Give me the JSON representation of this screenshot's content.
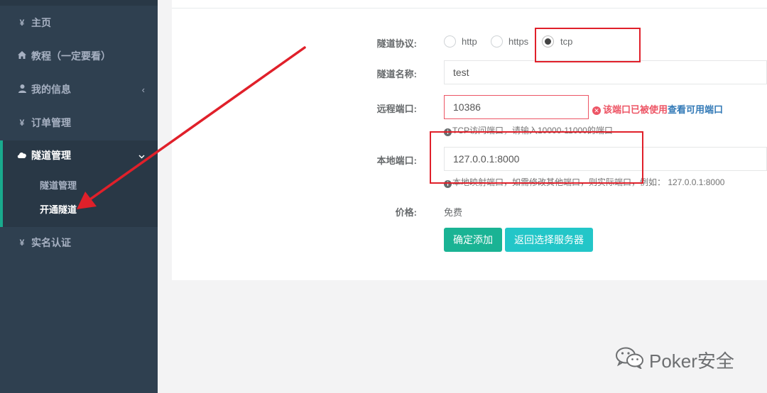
{
  "sidebar": {
    "items": [
      {
        "label": "主页",
        "icon": "yen-icon"
      },
      {
        "label": "教程（一定要看）",
        "icon": "home-icon"
      },
      {
        "label": "我的信息",
        "icon": "user-icon"
      },
      {
        "label": "订单管理",
        "icon": "yen-icon"
      },
      {
        "label": "隧道管理",
        "icon": "cloud-icon"
      },
      {
        "label": "实名认证",
        "icon": "yen-icon"
      }
    ],
    "sub_items": [
      {
        "label": "隧道管理"
      },
      {
        "label": "开通隧道"
      }
    ],
    "glyphs": {
      "yen": "¥",
      "caret_left": "‹",
      "caret_down": "⌄"
    }
  },
  "form": {
    "protocol": {
      "label": "隧道协议:",
      "options": [
        "http",
        "https",
        "tcp"
      ],
      "selected": "tcp"
    },
    "name": {
      "label": "隧道名称:",
      "value": "test"
    },
    "remote_port": {
      "label": "远程端口:",
      "value": "10386",
      "error_text": "该端口已被使用",
      "error_link": "查看可用端口",
      "help": "TCP访问端口，请输入10000-11000的端口"
    },
    "local_port": {
      "label": "本地端口:",
      "value": "127.0.0.1:8000",
      "help": "本地映射端口，如需修改其他端口，则实际端口，例如：  127.0.0.1:8000"
    },
    "price": {
      "label": "价格:",
      "value": "免费"
    },
    "buttons": {
      "confirm": "确定添加",
      "back": "返回选择服务器"
    }
  },
  "watermark": {
    "text": "Poker安全"
  },
  "colors": {
    "sidebar_bg": "#2f4050",
    "accent": "#1ab394",
    "info": "#23c6c8",
    "error": "#ed5565",
    "annotation_red": "#e0202a"
  }
}
